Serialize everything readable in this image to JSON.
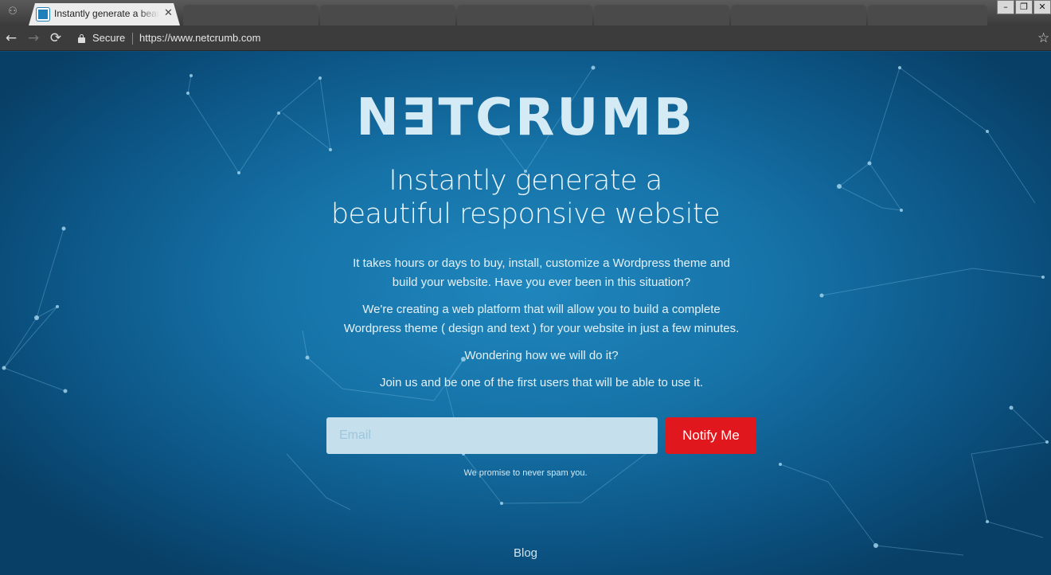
{
  "browser": {
    "tab_title": "Instantly generate a beautiful responsive website",
    "tab_close": "✕",
    "secure_label": "Secure",
    "url": "https://www.netcrumb.com",
    "window_controls": [
      "–",
      "❐",
      "✕"
    ],
    "nav": {
      "back": "←",
      "forward": "→",
      "reload": "⟳",
      "star": "☆"
    }
  },
  "page": {
    "logo": "N∃TCRUMB",
    "headline_line1": "Instantly generate a",
    "headline_line2": "beautiful responsive website",
    "intro_line1": "It takes hours or days to buy, install, customize a Wordpress theme and",
    "intro_line2": "build your website. Have you ever been in this situation?",
    "platform_line1": "We're creating a web platform that will allow you to build a complete",
    "platform_line2": "Wordpress theme ( design and text ) for your website in just a few minutes.",
    "wondering": "Wondering how we will do it?",
    "join": "Join us and be one of the first users that will be able to use it.",
    "email_placeholder": "Email",
    "notify_button": "Notify Me",
    "spam_note": "We promise to never spam you.",
    "blog_link": "Blog"
  },
  "colors": {
    "background": "#1673a8",
    "accent_button": "#e0171c",
    "logo": "#d4eaf4",
    "input_bg": "#c6dfec"
  }
}
